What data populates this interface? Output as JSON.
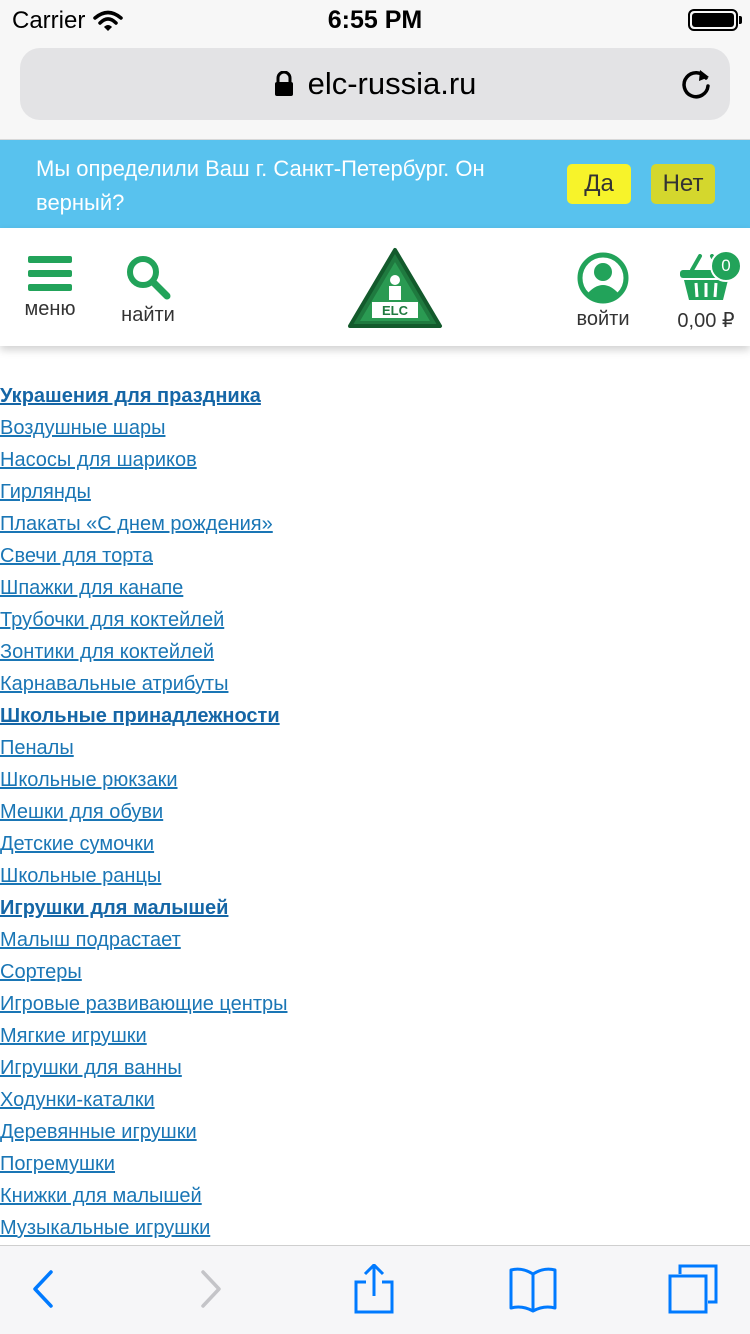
{
  "status_bar": {
    "carrier": "Carrier",
    "time": "6:55 PM"
  },
  "browser": {
    "url": "elc-russia.ru"
  },
  "city_banner": {
    "message": "Мы определили Ваш г. Санкт-Петербург. Он верный?",
    "yes_label": "Да",
    "no_label": "Нет"
  },
  "header": {
    "menu_label": "меню",
    "search_label": "найти",
    "login_label": "войти",
    "cart_count": "0",
    "cart_total": "0,00 ₽",
    "logo_text": "ELC"
  },
  "categories": [
    {
      "label": "Украшения для праздника",
      "heading": true
    },
    {
      "label": "Воздушные шары",
      "heading": false
    },
    {
      "label": "Насосы для шариков",
      "heading": false
    },
    {
      "label": "Гирлянды",
      "heading": false
    },
    {
      "label": "Плакаты «С днем рождения»",
      "heading": false
    },
    {
      "label": "Свечи для торта",
      "heading": false
    },
    {
      "label": "Шпажки для канапе",
      "heading": false
    },
    {
      "label": "Трубочки для коктейлей",
      "heading": false
    },
    {
      "label": "Зонтики для коктейлей",
      "heading": false
    },
    {
      "label": "Карнавальные атрибуты",
      "heading": false
    },
    {
      "label": "Школьные принадлежности",
      "heading": true
    },
    {
      "label": "Пеналы",
      "heading": false
    },
    {
      "label": "Школьные рюкзаки",
      "heading": false
    },
    {
      "label": "Мешки для обуви",
      "heading": false
    },
    {
      "label": "Детские сумочки",
      "heading": false
    },
    {
      "label": "Школьные ранцы",
      "heading": false
    },
    {
      "label": "Игрушки для малышей",
      "heading": true
    },
    {
      "label": "Малыш подрастает",
      "heading": false
    },
    {
      "label": "Сортеры",
      "heading": false
    },
    {
      "label": "Игровые развивающие центры",
      "heading": false
    },
    {
      "label": "Мягкие игрушки",
      "heading": false
    },
    {
      "label": "Игрушки для ванны",
      "heading": false
    },
    {
      "label": "Ходунки-каталки",
      "heading": false
    },
    {
      "label": "Деревянные игрушки",
      "heading": false
    },
    {
      "label": "Погремушки",
      "heading": false
    },
    {
      "label": "Книжки для малышей",
      "heading": false
    },
    {
      "label": "Музыкальные игрушки",
      "heading": false
    }
  ],
  "colors": {
    "brand_green": "#22a35a",
    "banner_blue": "#58c2ee",
    "link_blue": "#1a76b5",
    "ios_blue": "#007aff"
  },
  "icons": {
    "menu": "hamburger-icon",
    "search": "magnifier-icon",
    "login": "user-icon",
    "cart": "basket-icon",
    "toolbar": [
      "back-icon",
      "forward-icon",
      "share-icon",
      "bookmarks-icon",
      "tabs-icon"
    ]
  }
}
